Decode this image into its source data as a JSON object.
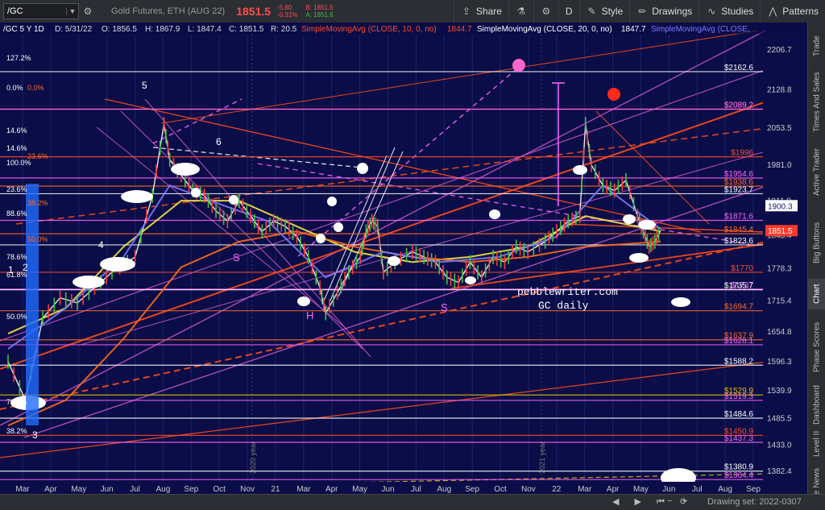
{
  "toolbar": {
    "symbol": "/GC",
    "description": "Gold Futures, ETH (AUG 22)",
    "last_price": "1851.5",
    "change": "-5.80",
    "change_pct": "-0.31%",
    "bid": "B: 1851.5",
    "ask": "A: 1851.6",
    "share_label": "Share",
    "period_label": "D",
    "style_label": "Style",
    "drawings_label": "Drawings",
    "studies_label": "Studies",
    "patterns_label": "Patterns",
    "colors": {
      "down": "#ff4d4d",
      "up": "#3ec43e"
    }
  },
  "side_tabs": [
    "Trade",
    "Times And Sales",
    "Active Trader",
    "Big Buttons",
    "Chart",
    "Phase Scores",
    "Dashboard",
    "Level II",
    "Live News"
  ],
  "status_bar": {
    "drawing_set": "Drawing set: 2022-0307",
    "zoom_out": "−",
    "zoom_in": "+"
  },
  "legend": {
    "header": "/GC 5 Y 1D",
    "date": "D: 5/31/22",
    "open": "O: 1856.5",
    "high": "H: 1867.9",
    "low": "L: 1847.4",
    "close": "C: 1851.5",
    "range": "R: 20.5",
    "sma10": "SimpleMovingAvg (CLOSE, 10, 0, no)",
    "sma10_val": "1844.7",
    "sma20": "SimpleMovingAvg (CLOSE, 20, 0, no)",
    "sma20_val": "1847.7",
    "sma_more": "SimpleMovingAvg (CLOSE,"
  },
  "watermark": {
    "line1": "pebblewriter.com",
    "line2": "GC daily"
  },
  "chart_data": {
    "type": "line",
    "title": "",
    "ylabel": "",
    "xlabel": "",
    "ylim": [
      1360,
      2235
    ],
    "y_ticks": [
      2206.7,
      2128.8,
      2053.5,
      1981,
      1911,
      1843.4,
      1778.3,
      1715.4,
      1654.8,
      1596.3,
      1539.9,
      1485.5,
      1433,
      1382.4
    ],
    "x_tick_labels": [
      "Mar",
      "Apr",
      "May",
      "Jun",
      "Jul",
      "Aug",
      "Sep",
      "Oct",
      "Nov",
      "21",
      "Mar",
      "Apr",
      "May",
      "Jun",
      "Jul",
      "Aug",
      "Sep",
      "Oct",
      "Nov",
      "22",
      "Mar",
      "Apr",
      "May",
      "Jun",
      "Jul",
      "Aug",
      "Sep"
    ],
    "year_markers": [
      "2020 year",
      "2021 year"
    ],
    "current_price": 1851.5,
    "current_price_label": "1851.5",
    "crosshair_price_label": "1900.3",
    "horizontal_levels": [
      {
        "label": "$2162.6",
        "value": 2162.6,
        "color": "#ffffff"
      },
      {
        "label": "$2089.2",
        "value": 2089.2,
        "color": "#ff6a2a"
      },
      {
        "label": "$2089.2",
        "value": 2089.2,
        "color": "#ff66ff"
      },
      {
        "label": "$1996",
        "value": 1996,
        "color": "#ff4d2a"
      },
      {
        "label": "$1954.6",
        "value": 1954.6,
        "color": "#ff66ff"
      },
      {
        "label": "$1938.6",
        "value": 1938.6,
        "color": "#ff6a2a"
      },
      {
        "label": "$1923.7",
        "value": 1923.7,
        "color": "#ffffff"
      },
      {
        "label": "$1871.6",
        "value": 1871.6,
        "color": "#ff66ff"
      },
      {
        "label": "$1845.4",
        "value": 1845.4,
        "color": "#ff6a2a"
      },
      {
        "label": "$1823.6",
        "value": 1823.6,
        "color": "#ffffff"
      },
      {
        "label": "$1770",
        "value": 1770,
        "color": "#ff4d2a"
      },
      {
        "label": "$1737",
        "value": 1737,
        "color": "#ff66ff"
      },
      {
        "label": "$1735.7",
        "value": 1735.7,
        "color": "#ffffff"
      },
      {
        "label": "$1694.7",
        "value": 1694.7,
        "color": "#ff6a2a"
      },
      {
        "label": "$1637.9",
        "value": 1637.9,
        "color": "#ff6a2a"
      },
      {
        "label": "$1628.1",
        "value": 1628.1,
        "color": "#ff66ff"
      },
      {
        "label": "$1588.2",
        "value": 1588.2,
        "color": "#ffffff"
      },
      {
        "label": "$1529.9",
        "value": 1529.9,
        "color": "#e0c000"
      },
      {
        "label": "$1519.3",
        "value": 1519.3,
        "color": "#ff66ff"
      },
      {
        "label": "$1484.6",
        "value": 1484.6,
        "color": "#ffffff"
      },
      {
        "label": "$1450.9",
        "value": 1450.9,
        "color": "#ff4d2a"
      },
      {
        "label": "$1437.3",
        "value": 1437.3,
        "color": "#ff66ff"
      },
      {
        "label": "$1380.9",
        "value": 1380.9,
        "color": "#ffffff"
      },
      {
        "label": "$1364.4",
        "value": 1364.4,
        "color": "#ff66ff"
      }
    ],
    "fib_labels": [
      "127.2%",
      "0.0%",
      "0.0%",
      "14.6%",
      "14.6%",
      "23.6%",
      "100.0%",
      "23.6%",
      "38.2%",
      "88.6%",
      "50.0%",
      "78.6%",
      "61.8%",
      "50.0%",
      "70.7%",
      "38.2%"
    ],
    "wave_labels": [
      "5",
      "6",
      "4",
      "1",
      "2",
      "3",
      "S",
      "H",
      "S"
    ],
    "series": [
      {
        "name": "Price",
        "color": "#e8e8e8",
        "points": [
          [
            0,
            1595
          ],
          [
            3,
            1520
          ],
          [
            6,
            1680
          ],
          [
            9,
            1720
          ],
          [
            12,
            1710
          ],
          [
            15,
            1740
          ],
          [
            18,
            1770
          ],
          [
            22,
            1800
          ],
          [
            25,
            1920
          ],
          [
            27,
            2060
          ],
          [
            28,
            1990
          ],
          [
            30,
            1960
          ],
          [
            32,
            1930
          ],
          [
            34,
            1920
          ],
          [
            36,
            1890
          ],
          [
            38,
            1870
          ],
          [
            40,
            1910
          ],
          [
            42,
            1880
          ],
          [
            44,
            1850
          ],
          [
            46,
            1870
          ],
          [
            48,
            1860
          ],
          [
            50,
            1840
          ],
          [
            52,
            1800
          ],
          [
            54,
            1740
          ],
          [
            55,
            1690
          ],
          [
            57,
            1730
          ],
          [
            59,
            1770
          ],
          [
            61,
            1800
          ],
          [
            62,
            1850
          ],
          [
            63,
            1870
          ],
          [
            64,
            1860
          ],
          [
            65,
            1770
          ],
          [
            67,
            1790
          ],
          [
            70,
            1810
          ],
          [
            72,
            1800
          ],
          [
            74,
            1790
          ],
          [
            76,
            1760
          ],
          [
            78,
            1750
          ],
          [
            80,
            1790
          ],
          [
            82,
            1760
          ],
          [
            84,
            1800
          ],
          [
            86,
            1790
          ],
          [
            88,
            1820
          ],
          [
            90,
            1810
          ],
          [
            93,
            1830
          ],
          [
            95,
            1850
          ],
          [
            97,
            1870
          ],
          [
            99,
            1880
          ],
          [
            100,
            2060
          ],
          [
            101,
            1980
          ],
          [
            103,
            1940
          ],
          [
            105,
            1930
          ],
          [
            107,
            1950
          ],
          [
            109,
            1880
          ],
          [
            110,
            1850
          ],
          [
            111,
            1820
          ],
          [
            112,
            1830
          ],
          [
            113,
            1851.5
          ]
        ]
      },
      {
        "name": "",
        "color": "#f5e642",
        "points": [
          [
            0,
            1650
          ],
          [
            10,
            1700
          ],
          [
            20,
            1820
          ],
          [
            30,
            1910
          ],
          [
            40,
            1910
          ],
          [
            50,
            1860
          ],
          [
            60,
            1810
          ],
          [
            70,
            1790
          ],
          [
            80,
            1800
          ],
          [
            90,
            1820
          ],
          [
            100,
            1880
          ],
          [
            113,
            1850
          ]
        ]
      },
      {
        "name": "",
        "color": "#ff6a1a",
        "points": [
          [
            0,
            1470
          ],
          [
            10,
            1520
          ],
          [
            20,
            1640
          ],
          [
            30,
            1780
          ],
          [
            40,
            1830
          ],
          [
            50,
            1850
          ],
          [
            60,
            1820
          ],
          [
            70,
            1800
          ],
          [
            80,
            1790
          ],
          [
            90,
            1800
          ],
          [
            100,
            1820
          ],
          [
            113,
            1830
          ]
        ]
      },
      {
        "name": "",
        "color": "#7a7aff",
        "points": [
          [
            0,
            1620
          ],
          [
            10,
            1700
          ],
          [
            20,
            1800
          ],
          [
            28,
            1940
          ],
          [
            35,
            1910
          ],
          [
            45,
            1870
          ],
          [
            55,
            1760
          ],
          [
            65,
            1810
          ],
          [
            75,
            1790
          ],
          [
            85,
            1800
          ],
          [
            95,
            1840
          ],
          [
            103,
            1940
          ],
          [
            110,
            1880
          ],
          [
            113,
            1855
          ]
        ]
      }
    ]
  }
}
